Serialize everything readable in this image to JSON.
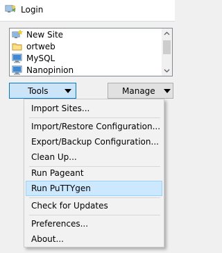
{
  "window": {
    "title": "Login"
  },
  "site_list": {
    "items": [
      {
        "label": "New Site",
        "icon": "new-site-icon"
      },
      {
        "label": "ortweb",
        "icon": "folder-icon"
      },
      {
        "label": "MySQL",
        "icon": "computer-icon"
      },
      {
        "label": "Nanopinion",
        "icon": "computer-icon"
      }
    ]
  },
  "buttons": {
    "tools_label": "Tools",
    "manage_label": "Manage"
  },
  "tools_menu": {
    "items": [
      "Import Sites...",
      "Import/Restore Configuration...",
      "Export/Backup Configuration...",
      "Clean Up...",
      "Run Pageant",
      "Run PuTTYgen",
      "Check for Updates",
      "Preferences...",
      "About..."
    ],
    "selected_item": "Run PuTTYgen"
  },
  "colors": {
    "menu_highlight": "#cce8ff",
    "menu_highlight_border": "#99d1ff",
    "tools_button_border": "#0078d7",
    "tools_button_fill": "#cce4f7"
  }
}
